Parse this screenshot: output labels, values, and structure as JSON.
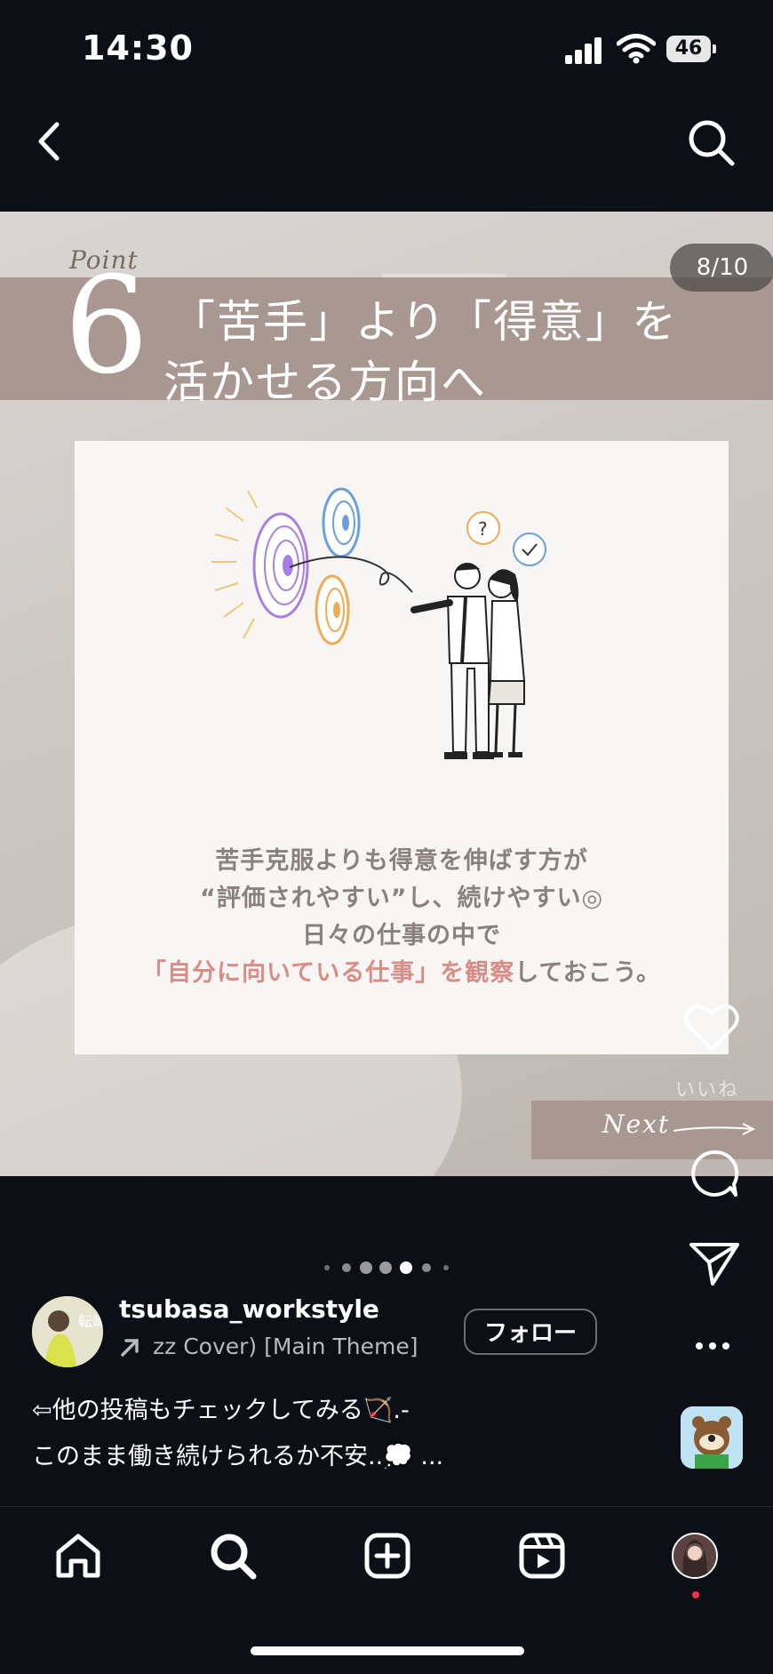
{
  "status_bar": {
    "time": "14:30",
    "battery": "46"
  },
  "post": {
    "point_label": "Point",
    "point_number": "6",
    "title_line1": "「苦手」より「得意」を",
    "title_line2": "活かせる方向へ",
    "counter": "8/10",
    "body_lines": [
      "苦手克服よりも得意を伸ばす方が",
      "“評価されやすい”し、続けやすい◎",
      "日々の仕事の中で"
    ],
    "body_highlight": "「自分に向いている仕事」を観察",
    "body_tail": "しておこう。",
    "next_label": "Next"
  },
  "actions": {
    "like_label": "いいね"
  },
  "profile": {
    "avatar_text": "転職",
    "username": "tsubasa_workstyle",
    "music": "zz Cover) [Main Theme]",
    "follow_label": "フォロー"
  },
  "caption": {
    "line1": "⇦他の投稿もチェックしてみる🏹.-",
    "line2": "このまま働き続けられるか不安..💭 ..."
  },
  "carousel": {
    "total_dots": 7,
    "active_dot": 4
  },
  "icons": {
    "back": "chevron-left-icon",
    "search": "search-icon",
    "heart": "heart-icon",
    "comment": "comment-icon",
    "share": "send-icon",
    "more": "more-icon",
    "home": "home-icon",
    "explore": "search-icon",
    "create": "plus-square-icon",
    "reels": "reels-icon"
  },
  "colors": {
    "band": "#a99891",
    "highlight": "#d98d86",
    "notification": "#ff2d44"
  }
}
